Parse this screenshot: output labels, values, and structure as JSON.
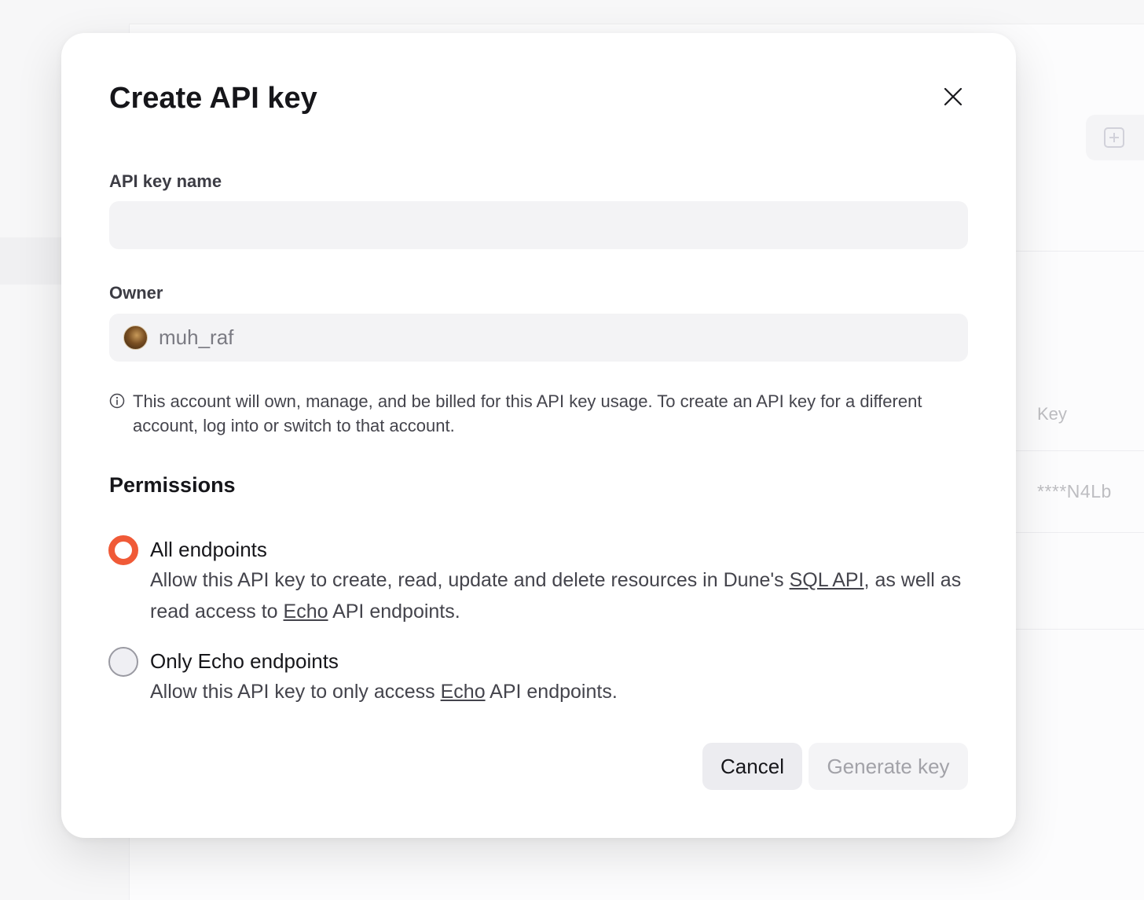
{
  "background": {
    "table": {
      "key_column_header": "Key",
      "key_value": "****N4Lb"
    }
  },
  "modal": {
    "title": "Create API key",
    "name_field": {
      "label": "API key name",
      "value": "",
      "placeholder": ""
    },
    "owner_field": {
      "label": "Owner",
      "value": "muh_raf"
    },
    "info_note": "This account will own, manage, and be billed for this API key usage. To create an API key for a different account, log into or switch to that account.",
    "permissions": {
      "heading": "Permissions",
      "options": [
        {
          "title": "All endpoints",
          "desc_part1": "Allow this API key to create, read, update and delete resources in Dune's ",
          "link1": "SQL API",
          "desc_part2": ", as well as read access to ",
          "link2": "Echo",
          "desc_part3": " API endpoints.",
          "selected": true
        },
        {
          "title": "Only Echo endpoints",
          "desc_part1": "Allow this API key to only access ",
          "link1": "Echo",
          "desc_part2": " API endpoints.",
          "selected": false
        }
      ]
    },
    "buttons": {
      "cancel": "Cancel",
      "generate": "Generate key"
    }
  },
  "colors": {
    "accent": "#f05a37",
    "input_bg": "#f3f3f5",
    "disabled_text": "#a2a2a8"
  }
}
